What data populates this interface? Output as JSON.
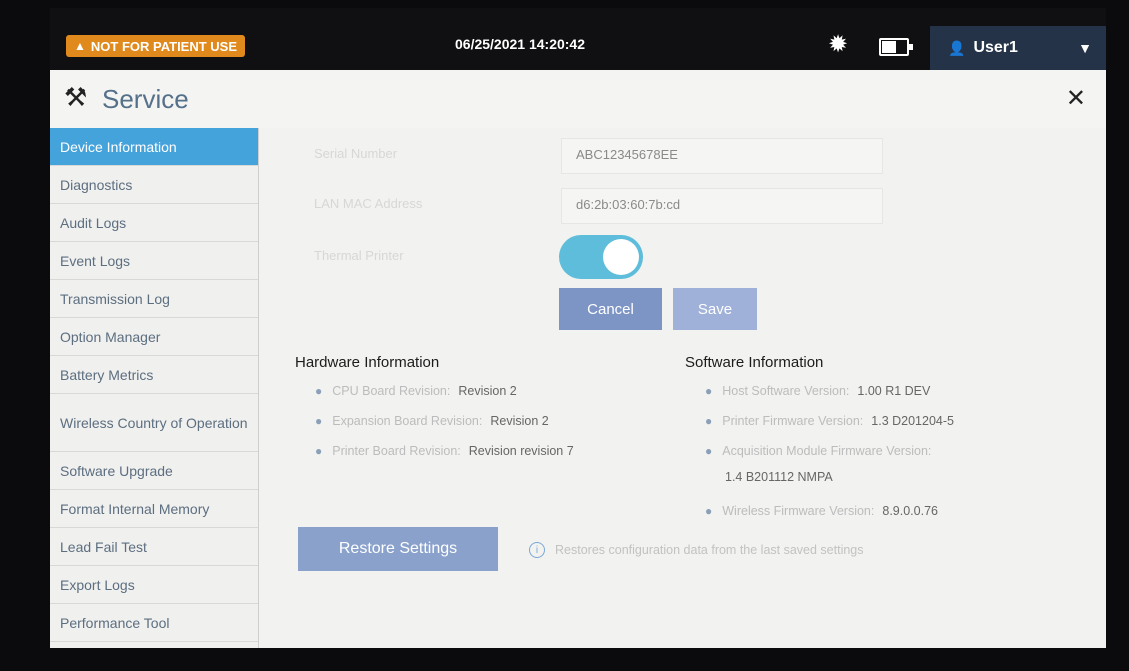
{
  "status_bar": {
    "warning": "NOT FOR PATIENT USE",
    "datetime": "06/25/2021 14:20:42",
    "user": "User1"
  },
  "header": {
    "title": "Service"
  },
  "sidebar": {
    "items": [
      {
        "label": "Device Information"
      },
      {
        "label": "Diagnostics"
      },
      {
        "label": "Audit Logs"
      },
      {
        "label": "Event Logs"
      },
      {
        "label": "Transmission Log"
      },
      {
        "label": "Option Manager"
      },
      {
        "label": "Battery Metrics"
      },
      {
        "label": "Wireless Country of Operation"
      },
      {
        "label": "Software Upgrade"
      },
      {
        "label": "Format Internal Memory"
      },
      {
        "label": "Lead Fail Test"
      },
      {
        "label": "Export Logs"
      },
      {
        "label": "Performance Tool"
      }
    ]
  },
  "device": {
    "serial_label": "Serial Number",
    "serial_value": "ABC12345678EE",
    "mac_label": "LAN MAC Address",
    "mac_value": "d6:2b:03:60:7b:cd",
    "printer_label": "Thermal Printer",
    "printer_enabled": true
  },
  "buttons": {
    "cancel": "Cancel",
    "save": "Save",
    "restore": "Restore Settings"
  },
  "hardware": {
    "title": "Hardware Information",
    "items": [
      {
        "label": "CPU Board Revision:",
        "value": "Revision 2"
      },
      {
        "label": "Expansion Board Revision:",
        "value": "Revision 2"
      },
      {
        "label": "Printer Board Revision:",
        "value": "Revision revision 7"
      }
    ]
  },
  "software": {
    "title": "Software Information",
    "items": [
      {
        "label": "Host Software Version:",
        "value": "1.00 R1 DEV"
      },
      {
        "label": "Printer Firmware Version:",
        "value": "1.3 D201204-5"
      },
      {
        "label": "Acquisition Module Firmware Version:",
        "value": "1.4 B201112 NMPA"
      },
      {
        "label": "Wireless Firmware Version:",
        "value": "8.9.0.0.76"
      }
    ]
  },
  "restore_hint": "Restores configuration data from the last saved settings"
}
